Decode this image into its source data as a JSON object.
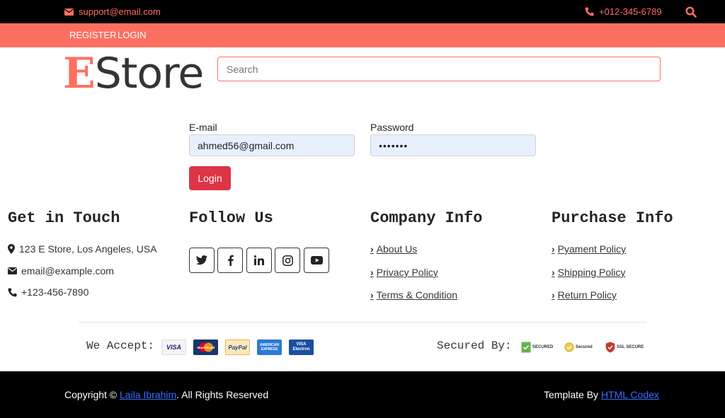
{
  "topbar": {
    "email": "support@email.com",
    "phone": "+012-345-6789",
    "icons": {
      "email": "envelope-icon",
      "phone": "phone-icon",
      "search": "search-icon"
    }
  },
  "nav": {
    "register": "REGISTER",
    "login": "LOGIN"
  },
  "brand": {
    "first_letter": "E",
    "rest": "Store"
  },
  "search": {
    "placeholder": "Search"
  },
  "login_form": {
    "email_label": "E-mail",
    "email_value": "ahmed56@gmail.com",
    "password_label": "Password",
    "password_value": "•••••••",
    "submit": "Login"
  },
  "footer": {
    "contact": {
      "title": "Get in Touch",
      "address": "123 E Store, Los Angeles, USA",
      "email": "email@example.com",
      "phone": "+123-456-7890"
    },
    "follow": {
      "title": "Follow Us",
      "icons": [
        "twitter-icon",
        "facebook-icon",
        "linkedin-icon",
        "instagram-icon",
        "youtube-icon"
      ]
    },
    "company": {
      "title": "Company Info",
      "links": [
        "About Us",
        "Privacy Policy",
        "Terms & Condition"
      ]
    },
    "purchase": {
      "title": "Purchase Info",
      "links": [
        "Pyament Policy",
        "Shipping Policy",
        "Return Policy"
      ]
    },
    "payment": {
      "label": "We Accept:",
      "cards": [
        "VISA",
        "MasterCard",
        "PayPal",
        "AMERICAN EXPRESS",
        "VISA Electron"
      ]
    },
    "security": {
      "label": "Secured By:",
      "seals": [
        "SECURED",
        "Secured",
        "SSL SECURE"
      ]
    }
  },
  "bottom": {
    "copyright_prefix": "Copyright © ",
    "copyright_link": "Laila Ibrahim",
    "copyright_suffix": ". All Rights Reserved",
    "template_prefix": "Template By ",
    "template_link": "HTML Codex"
  },
  "colors": {
    "accent": "#ff6f61",
    "danger": "#dc3545",
    "dark": "#000000",
    "link": "#3b6cff"
  }
}
